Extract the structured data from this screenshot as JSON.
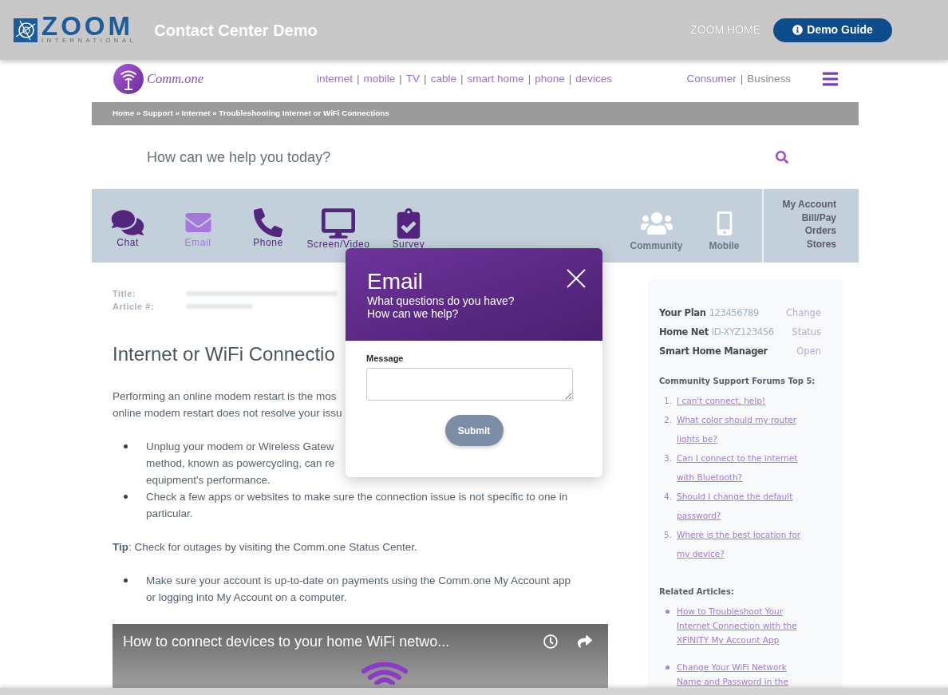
{
  "top_bar": {
    "logo": {
      "wordmark": "ZOOM",
      "tagline": "INTERNATIONAL"
    },
    "title": "Contact Center Demo",
    "home_link": "ZOOM HOME",
    "guide_button": "Demo Guide"
  },
  "site_header": {
    "logo_text": "Comm.one",
    "nav": {
      "links": [
        "internet",
        "mobile",
        "TV",
        "cable",
        "smart home",
        "phone",
        "devices"
      ],
      "separator": "|"
    },
    "segments": {
      "items": [
        {
          "label": "Consumer",
          "selected": true
        },
        {
          "label": "Business",
          "selected": false
        }
      ],
      "separator": "|"
    }
  },
  "breadcrumb": "Home » Support » Internet » Troubleshooting Internet or WiFi Connections",
  "search": {
    "placeholder": "How can we help you today?"
  },
  "contact_bar": {
    "channels": [
      {
        "label": "Chat",
        "selected": false
      },
      {
        "label": "Email",
        "selected": true
      },
      {
        "label": "Phone",
        "selected": false
      },
      {
        "label": "Screen/Video",
        "selected": false
      },
      {
        "label": "Survey",
        "selected": false
      }
    ],
    "community": [
      "Community",
      "Mobile"
    ],
    "account_links": [
      "My Account",
      "Bill/Pay",
      "Orders",
      "Stores"
    ]
  },
  "article": {
    "meta_labels": [
      "Title:",
      "Article #:"
    ],
    "heading": "Internet or WiFi Connectio",
    "intro_lines": [
      "Performing an online modem restart is the mos",
      "online modem restart does not resolve your issu"
    ],
    "steps": [
      {
        "lines": [
          "Unplug your modem or Wireless Gatew",
          "method, known as powercycling, can re",
          "equipment's performance."
        ]
      },
      {
        "lines": [
          "Check a few apps or websites to make sure the connection issue is not specific to one in",
          "particular."
        ]
      }
    ],
    "tip": "**Tip**: Check for outages by visiting the Comm.one Status Center.",
    "more_steps": [
      {
        "lines": [
          "Make sure your account is up-to-date on payments using the Comm.one My Account app",
          "or logging into My Account on a computer."
        ]
      }
    ],
    "video": {
      "title": "How to connect devices to your home WiFi netwo..."
    }
  },
  "sidebar": {
    "account_rows": [
      {
        "label": "Your Plan",
        "value": "123456789",
        "action": "Change"
      },
      {
        "label": "Home Net",
        "value": "ID-XYZ123456",
        "action": "Status"
      },
      {
        "label": "Smart Home Manager",
        "action": "Open"
      }
    ],
    "forums": {
      "heading": "Community Support Forums Top 5:",
      "items": [
        {
          "number": "1.",
          "text": "I can't connect, help!"
        },
        {
          "number": "2.",
          "text": "What color should my router lights be?"
        },
        {
          "number": "3.",
          "text": "Can I connect to the internet with Bluetooth?"
        },
        {
          "number": "4.",
          "text": "Should I change the default password?"
        },
        {
          "number": "5.",
          "text": "Where is the best location for my device?"
        }
      ]
    },
    "related": {
      "heading": "Related Articles:",
      "items": [
        "How to Troubleshoot Your Internet Connection with the XFINITY My Account App",
        "Change Your WiFi Network Name and Password in the"
      ]
    }
  },
  "email_dialog": {
    "title": "Email",
    "subtitle_lines": [
      "What questions do you have?",
      "How can we help?"
    ],
    "field_label": "Message",
    "submit": "Submit"
  }
}
